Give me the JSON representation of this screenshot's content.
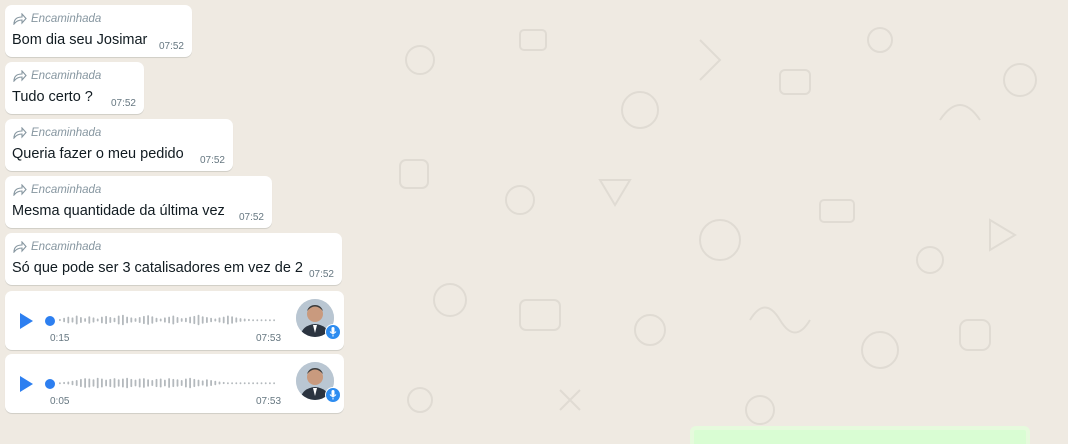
{
  "forwarded_label": "Encaminhada",
  "messages": [
    {
      "text": "Bom dia seu Josimar",
      "time": "07:52"
    },
    {
      "text": "Tudo certo ?",
      "time": "07:52"
    },
    {
      "text": "Queria fazer o meu pedido",
      "time": "07:52"
    },
    {
      "text": "Mesma quantidade da última vez",
      "time": "07:52"
    },
    {
      "text": "Só que pode ser 3 catalisadores em vez de 2",
      "time": "07:52"
    }
  ],
  "voice_messages": [
    {
      "duration": "0:15",
      "time": "07:53",
      "progress": 0
    },
    {
      "duration": "0:05",
      "time": "07:53",
      "progress": 0
    }
  ],
  "colors": {
    "background": "#efeae2",
    "bubble_in": "#ffffff",
    "play_accent": "#2d7ff0",
    "mic_badge": "#2d8cf0",
    "outgoing_bubble": "#d9fdd3"
  }
}
